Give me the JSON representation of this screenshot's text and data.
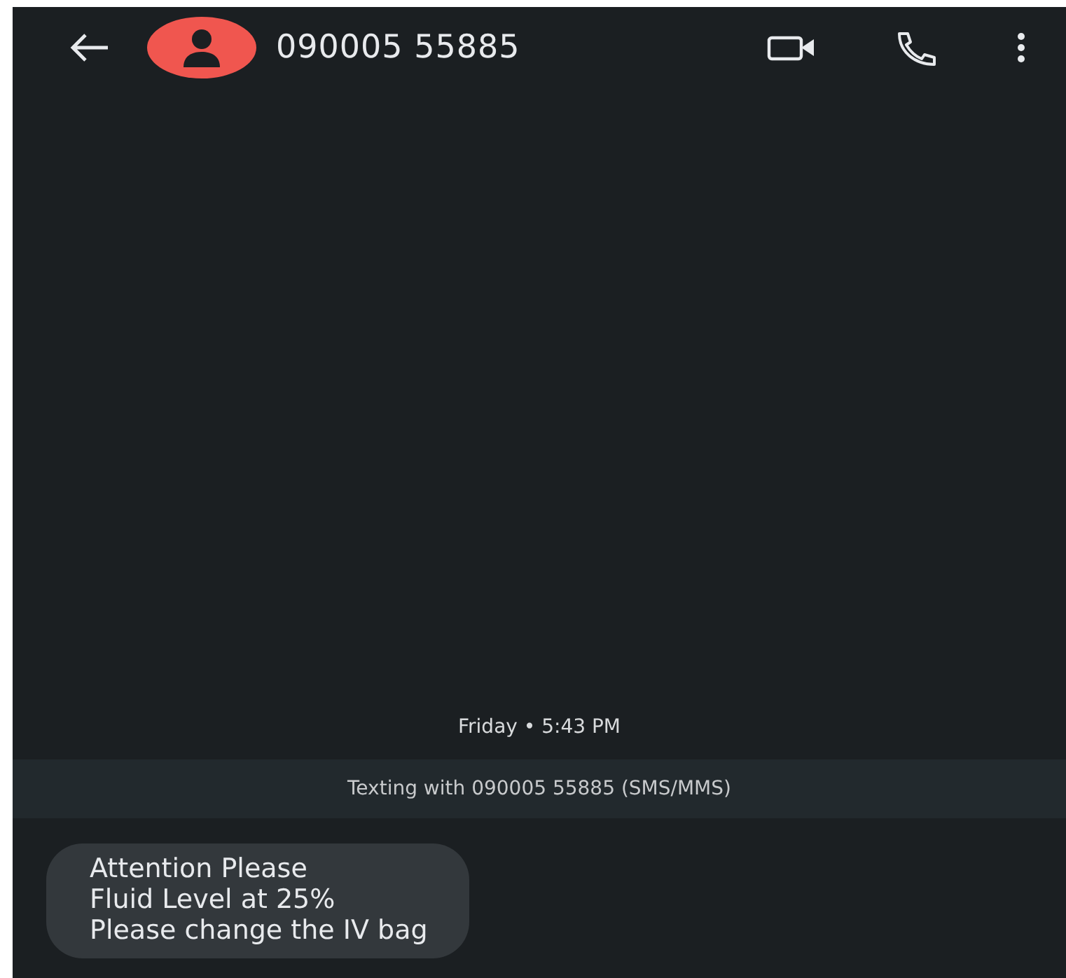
{
  "header": {
    "contact": "090005 55885"
  },
  "timestamp": "Friday • 5:43 PM",
  "banner": "Texting with 090005 55885 (SMS/MMS)",
  "messages": [
    {
      "kind": "incoming",
      "text": "Attention Please\nFluid Level at 25%\nPlease change the IV bag"
    }
  ]
}
